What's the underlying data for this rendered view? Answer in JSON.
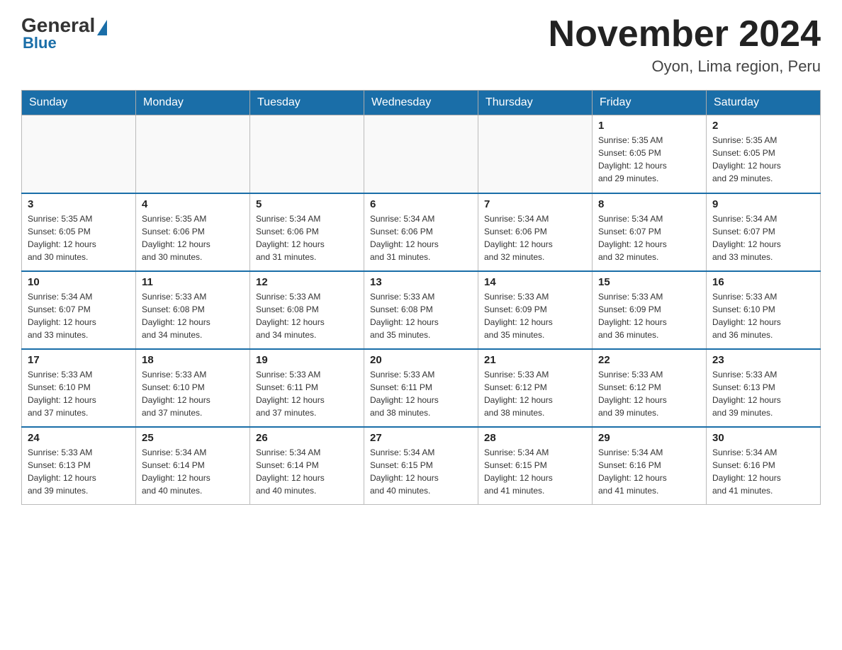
{
  "logo": {
    "general": "General",
    "blue": "Blue"
  },
  "header": {
    "month": "November 2024",
    "location": "Oyon, Lima region, Peru"
  },
  "weekdays": [
    "Sunday",
    "Monday",
    "Tuesday",
    "Wednesday",
    "Thursday",
    "Friday",
    "Saturday"
  ],
  "weeks": [
    [
      {
        "day": "",
        "info": ""
      },
      {
        "day": "",
        "info": ""
      },
      {
        "day": "",
        "info": ""
      },
      {
        "day": "",
        "info": ""
      },
      {
        "day": "",
        "info": ""
      },
      {
        "day": "1",
        "info": "Sunrise: 5:35 AM\nSunset: 6:05 PM\nDaylight: 12 hours\nand 29 minutes."
      },
      {
        "day": "2",
        "info": "Sunrise: 5:35 AM\nSunset: 6:05 PM\nDaylight: 12 hours\nand 29 minutes."
      }
    ],
    [
      {
        "day": "3",
        "info": "Sunrise: 5:35 AM\nSunset: 6:05 PM\nDaylight: 12 hours\nand 30 minutes."
      },
      {
        "day": "4",
        "info": "Sunrise: 5:35 AM\nSunset: 6:06 PM\nDaylight: 12 hours\nand 30 minutes."
      },
      {
        "day": "5",
        "info": "Sunrise: 5:34 AM\nSunset: 6:06 PM\nDaylight: 12 hours\nand 31 minutes."
      },
      {
        "day": "6",
        "info": "Sunrise: 5:34 AM\nSunset: 6:06 PM\nDaylight: 12 hours\nand 31 minutes."
      },
      {
        "day": "7",
        "info": "Sunrise: 5:34 AM\nSunset: 6:06 PM\nDaylight: 12 hours\nand 32 minutes."
      },
      {
        "day": "8",
        "info": "Sunrise: 5:34 AM\nSunset: 6:07 PM\nDaylight: 12 hours\nand 32 minutes."
      },
      {
        "day": "9",
        "info": "Sunrise: 5:34 AM\nSunset: 6:07 PM\nDaylight: 12 hours\nand 33 minutes."
      }
    ],
    [
      {
        "day": "10",
        "info": "Sunrise: 5:34 AM\nSunset: 6:07 PM\nDaylight: 12 hours\nand 33 minutes."
      },
      {
        "day": "11",
        "info": "Sunrise: 5:33 AM\nSunset: 6:08 PM\nDaylight: 12 hours\nand 34 minutes."
      },
      {
        "day": "12",
        "info": "Sunrise: 5:33 AM\nSunset: 6:08 PM\nDaylight: 12 hours\nand 34 minutes."
      },
      {
        "day": "13",
        "info": "Sunrise: 5:33 AM\nSunset: 6:08 PM\nDaylight: 12 hours\nand 35 minutes."
      },
      {
        "day": "14",
        "info": "Sunrise: 5:33 AM\nSunset: 6:09 PM\nDaylight: 12 hours\nand 35 minutes."
      },
      {
        "day": "15",
        "info": "Sunrise: 5:33 AM\nSunset: 6:09 PM\nDaylight: 12 hours\nand 36 minutes."
      },
      {
        "day": "16",
        "info": "Sunrise: 5:33 AM\nSunset: 6:10 PM\nDaylight: 12 hours\nand 36 minutes."
      }
    ],
    [
      {
        "day": "17",
        "info": "Sunrise: 5:33 AM\nSunset: 6:10 PM\nDaylight: 12 hours\nand 37 minutes."
      },
      {
        "day": "18",
        "info": "Sunrise: 5:33 AM\nSunset: 6:10 PM\nDaylight: 12 hours\nand 37 minutes."
      },
      {
        "day": "19",
        "info": "Sunrise: 5:33 AM\nSunset: 6:11 PM\nDaylight: 12 hours\nand 37 minutes."
      },
      {
        "day": "20",
        "info": "Sunrise: 5:33 AM\nSunset: 6:11 PM\nDaylight: 12 hours\nand 38 minutes."
      },
      {
        "day": "21",
        "info": "Sunrise: 5:33 AM\nSunset: 6:12 PM\nDaylight: 12 hours\nand 38 minutes."
      },
      {
        "day": "22",
        "info": "Sunrise: 5:33 AM\nSunset: 6:12 PM\nDaylight: 12 hours\nand 39 minutes."
      },
      {
        "day": "23",
        "info": "Sunrise: 5:33 AM\nSunset: 6:13 PM\nDaylight: 12 hours\nand 39 minutes."
      }
    ],
    [
      {
        "day": "24",
        "info": "Sunrise: 5:33 AM\nSunset: 6:13 PM\nDaylight: 12 hours\nand 39 minutes."
      },
      {
        "day": "25",
        "info": "Sunrise: 5:34 AM\nSunset: 6:14 PM\nDaylight: 12 hours\nand 40 minutes."
      },
      {
        "day": "26",
        "info": "Sunrise: 5:34 AM\nSunset: 6:14 PM\nDaylight: 12 hours\nand 40 minutes."
      },
      {
        "day": "27",
        "info": "Sunrise: 5:34 AM\nSunset: 6:15 PM\nDaylight: 12 hours\nand 40 minutes."
      },
      {
        "day": "28",
        "info": "Sunrise: 5:34 AM\nSunset: 6:15 PM\nDaylight: 12 hours\nand 41 minutes."
      },
      {
        "day": "29",
        "info": "Sunrise: 5:34 AM\nSunset: 6:16 PM\nDaylight: 12 hours\nand 41 minutes."
      },
      {
        "day": "30",
        "info": "Sunrise: 5:34 AM\nSunset: 6:16 PM\nDaylight: 12 hours\nand 41 minutes."
      }
    ]
  ]
}
